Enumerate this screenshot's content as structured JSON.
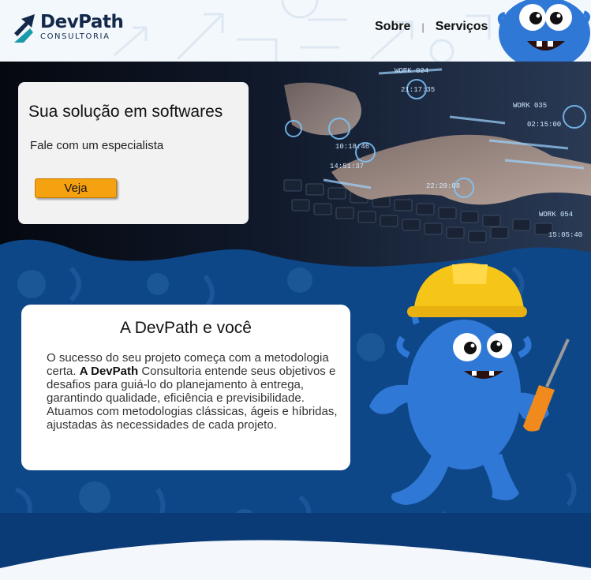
{
  "header": {
    "logo_name": "DevPath",
    "logo_sub": "CONSULTORIA",
    "nav": [
      "Sobre",
      "Serviços"
    ]
  },
  "hero": {
    "title": "Sua solução em softwares",
    "subtitle": "Fale com um especialista",
    "button_label": "Veja",
    "bg_labels": [
      "WORK 024",
      "WORK 035",
      "WORK 054",
      "21:17:35",
      "02:15:00",
      "10:18:46",
      "14:51:37",
      "22:20:08",
      "15:05:40"
    ]
  },
  "about": {
    "title": "A DevPath e você",
    "text_before": "O sucesso do seu projeto começa com a metodologia certa. ",
    "text_bold": "A DevPath",
    "text_after": " Consultoria entende seus objetivos e desafios para guiá-lo do planejamento à entrega, garantindo qualidade, eficiência e previsibilidade. Atuamos com metodologias clássicas, ágeis e híbridas, ajustadas às necessidades de cada projeto."
  },
  "colors": {
    "brand_navy": "#13294b",
    "brand_teal": "#1b9aa8",
    "button_orange": "#f6a10f",
    "section_blue": "#0e4788",
    "mascot_blue": "#2f78d6"
  },
  "icons": [
    "logo-arrow-icon",
    "mascot-head-image",
    "mascot-builder-image"
  ]
}
